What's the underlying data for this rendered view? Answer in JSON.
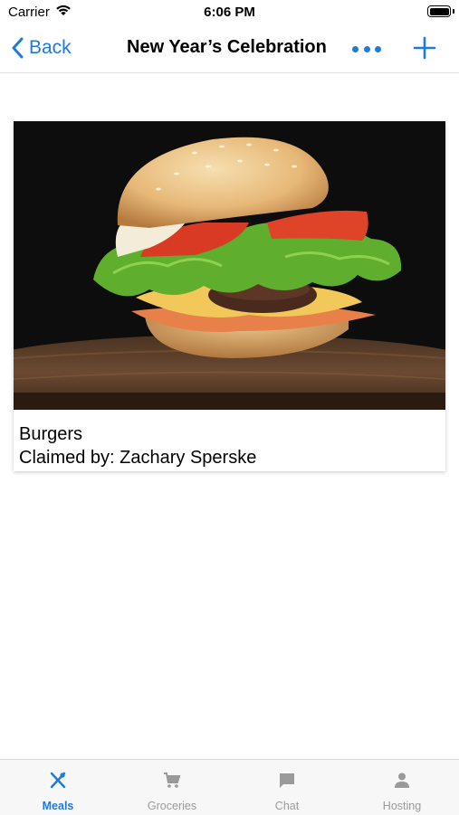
{
  "status_bar": {
    "carrier": "Carrier",
    "time": "6:06 PM"
  },
  "nav": {
    "back_label": "Back",
    "title": "New Year’s Celebration",
    "more_icon": "ellipsis-icon",
    "add_icon": "plus-icon",
    "accent_color": "#1e7ae0"
  },
  "meals": [
    {
      "name": "Burgers",
      "claimed_by": "Claimed by: Zachary Sperske",
      "image": "burger-photo"
    }
  ],
  "tabs": [
    {
      "label": "Meals",
      "icon": "fork-knife-icon",
      "active": true
    },
    {
      "label": "Groceries",
      "icon": "cart-icon",
      "active": false
    },
    {
      "label": "Chat",
      "icon": "chat-bubble-icon",
      "active": false
    },
    {
      "label": "Hosting",
      "icon": "person-icon",
      "active": false
    }
  ]
}
